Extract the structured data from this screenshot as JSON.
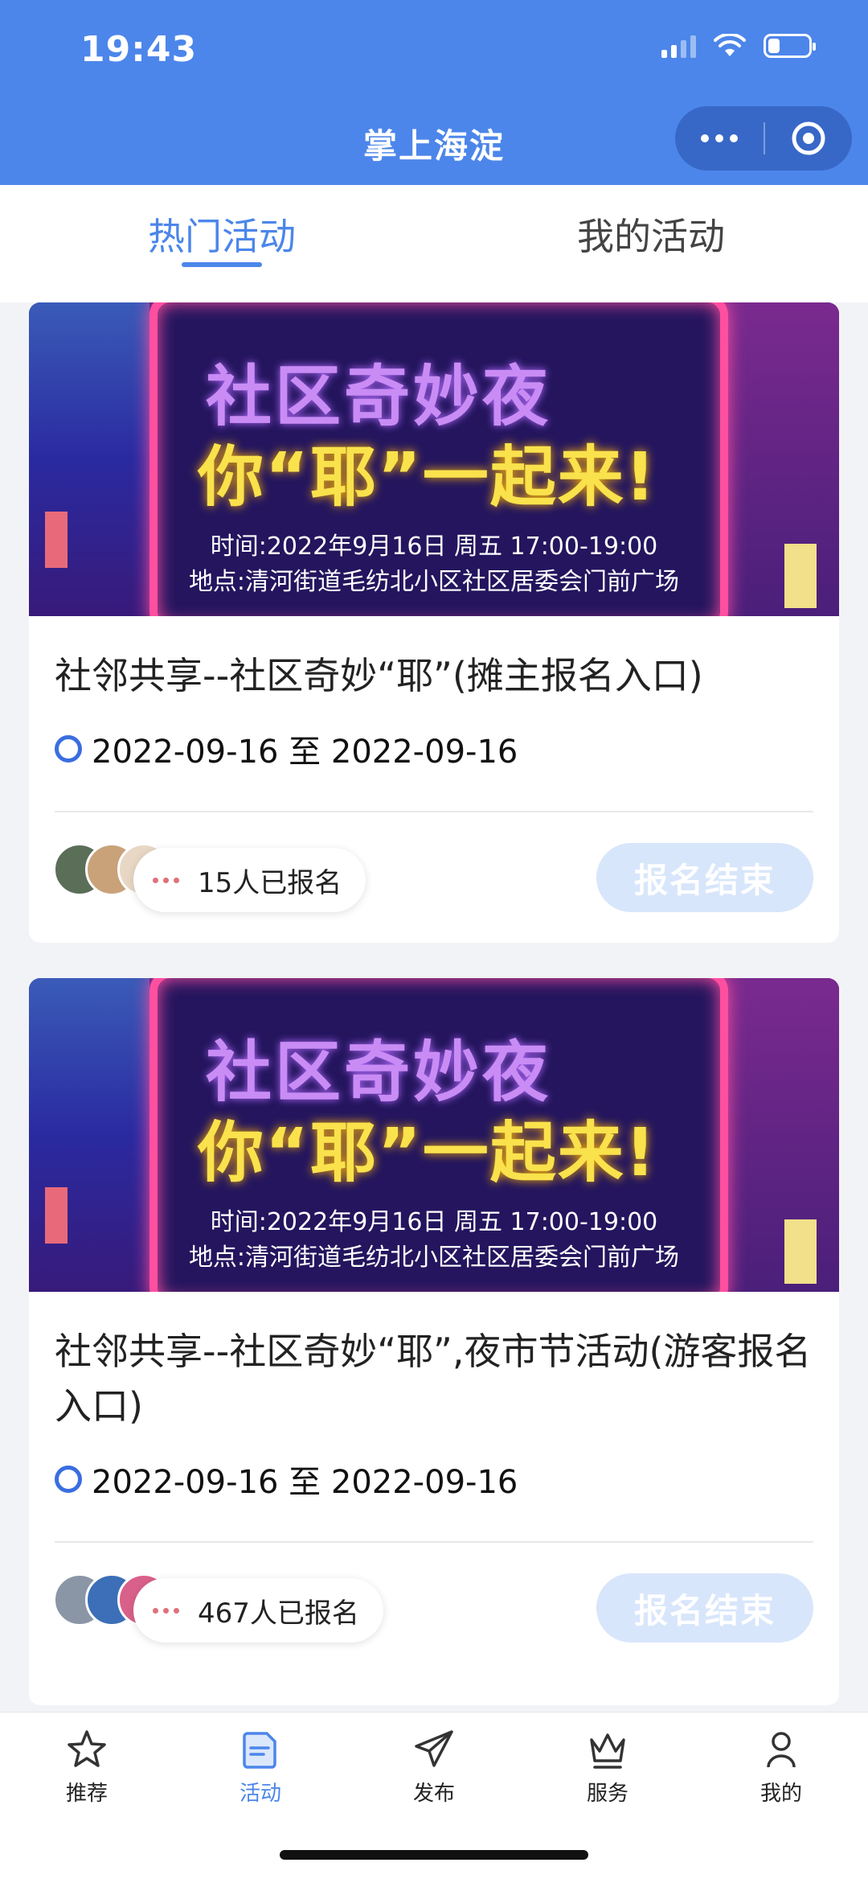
{
  "status_bar": {
    "time": "19:43"
  },
  "nav": {
    "title": "掌上海淀"
  },
  "tabs": [
    {
      "label": "热门活动",
      "active": true
    },
    {
      "label": "我的活动",
      "active": false
    }
  ],
  "cards": [
    {
      "banner": {
        "line1": "社区奇妙夜",
        "line2": "你“耶”一起来!",
        "time": "时间:2022年9月16日 周五 17:00-19:00",
        "place": "地点:清河街道毛纺北小区社区居委会门前广场"
      },
      "title": "社邻共享--社区奇妙“耶”(摊主报名入口)",
      "date_range": "2022-09-16 至 2022-09-16",
      "signup_count": "15人已报名",
      "status_button": "报名结束"
    },
    {
      "banner": {
        "line1": "社区奇妙夜",
        "line2": "你“耶”一起来!",
        "time": "时间:2022年9月16日 周五 17:00-19:00",
        "place": "地点:清河街道毛纺北小区社区居委会门前广场"
      },
      "title": "社邻共享--社区奇妙“耶”,夜市节活动(游客报名入口)",
      "date_range": "2022-09-16 至 2022-09-16",
      "signup_count": "467人已报名",
      "status_button": "报名结束"
    }
  ],
  "bottom_nav": [
    {
      "label": "推荐",
      "icon": "star-icon"
    },
    {
      "label": "活动",
      "icon": "activity-icon",
      "active": true
    },
    {
      "label": "发布",
      "icon": "paper-plane-icon"
    },
    {
      "label": "服务",
      "icon": "crown-icon"
    },
    {
      "label": "我的",
      "icon": "user-icon"
    }
  ],
  "colors": {
    "brand": "#4c86ea",
    "disabled_button": "#d8e6fb"
  }
}
